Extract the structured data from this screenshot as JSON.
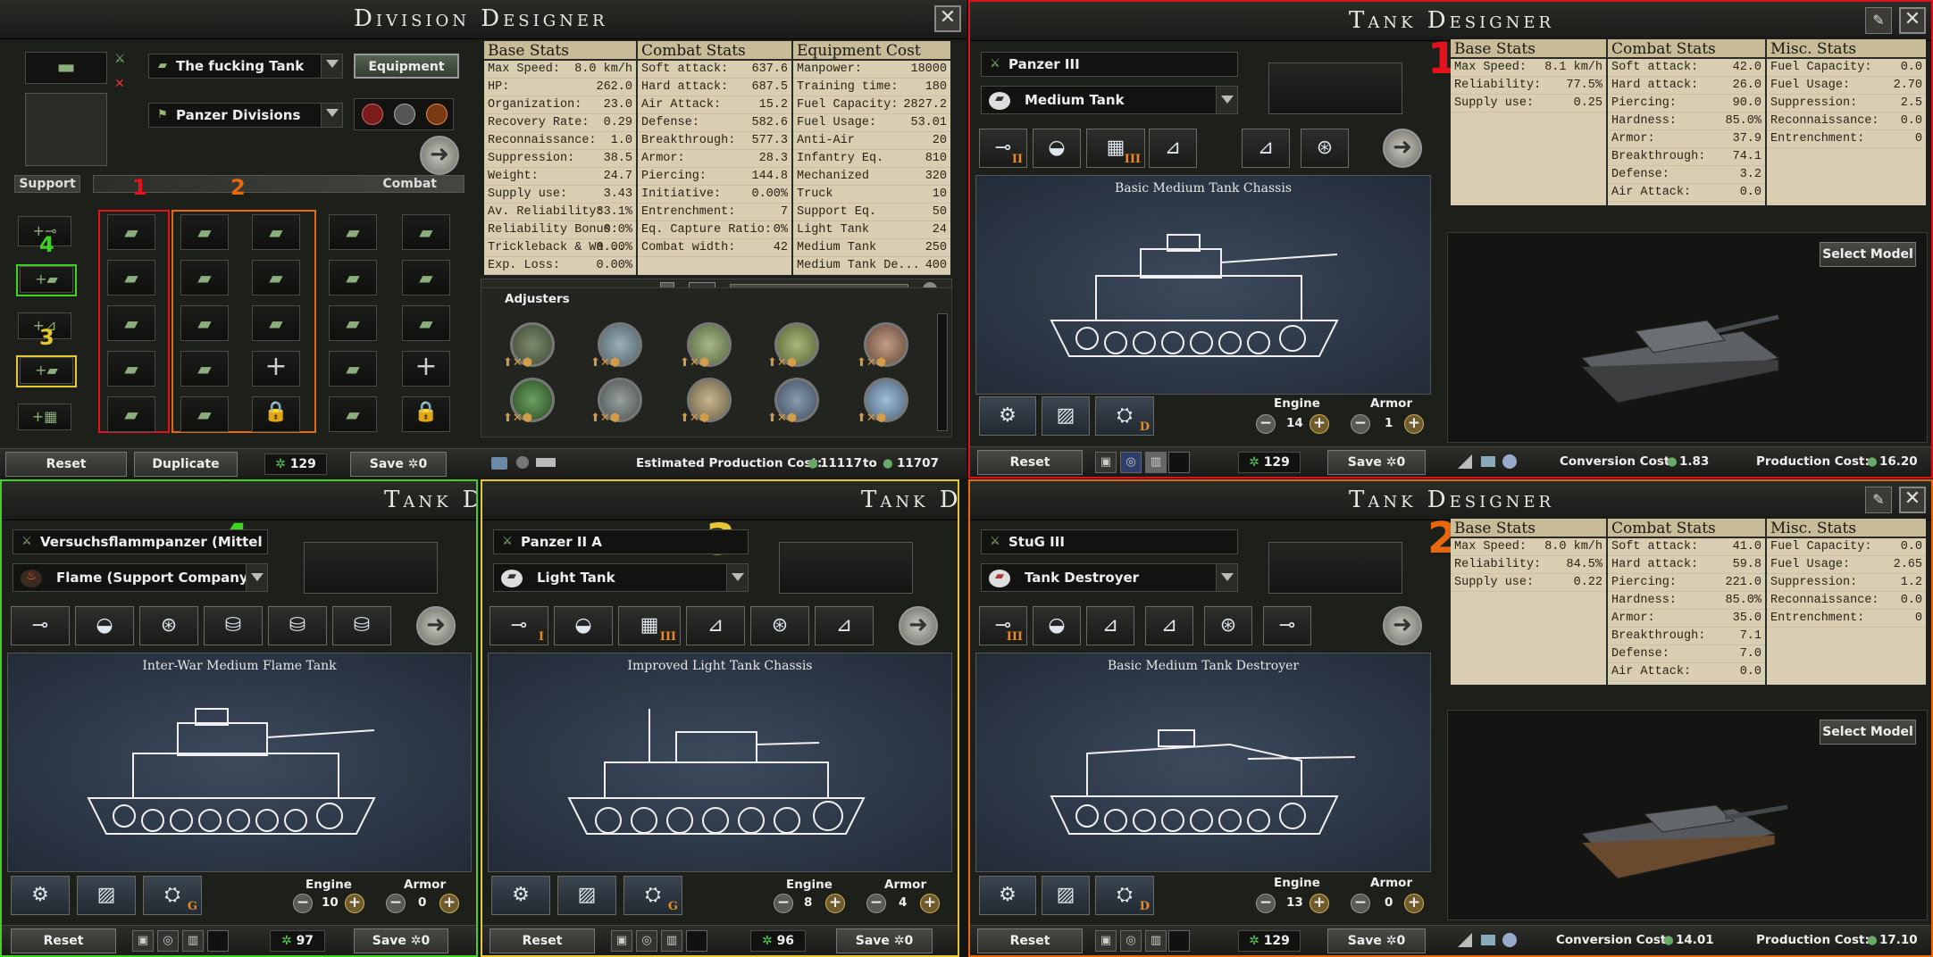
{
  "division": {
    "title": "Division Designer",
    "close": "✕",
    "name": "The fucking Tank",
    "equipment_button": "Equipment",
    "template_group": "Panzer Divisions",
    "support_label": "Support",
    "combat_label": "Combat",
    "column_markers": [
      "1",
      "2"
    ],
    "support_markers": [
      "4",
      "3"
    ],
    "headers": [
      "Base Stats",
      "Combat Stats",
      "Equipment Cost"
    ],
    "base_stats": [
      [
        "Max Speed:",
        "8.0 km/h"
      ],
      [
        "HP:",
        "262.0"
      ],
      [
        "Organization:",
        "23.0"
      ],
      [
        "Recovery Rate:",
        "0.29"
      ],
      [
        "Reconnaissance:",
        "1.0"
      ],
      [
        "Suppression:",
        "38.5"
      ],
      [
        "Weight:",
        "24.7"
      ],
      [
        "Supply use:",
        "3.43"
      ],
      [
        "Av. Reliability:",
        "83.1%"
      ],
      [
        "Reliability Bonus:",
        "0.0%"
      ],
      [
        "Trickleback & Wa...",
        "0.00%"
      ],
      [
        "Exp. Loss:",
        "0.00%"
      ]
    ],
    "combat_stats": [
      [
        "Soft attack:",
        "637.6"
      ],
      [
        "Hard attack:",
        "687.5"
      ],
      [
        "Air Attack:",
        "15.2"
      ],
      [
        "Defense:",
        "582.6"
      ],
      [
        "Breakthrough:",
        "577.3"
      ],
      [
        "Armor:",
        "28.3"
      ],
      [
        "Piercing:",
        "144.8"
      ],
      [
        "Initiative:",
        "0.00%"
      ],
      [
        "Entrenchment:",
        "7"
      ],
      [
        "Eq. Capture Ratio:",
        "0%"
      ],
      [
        "Combat width:",
        "42"
      ]
    ],
    "equipment_cost": [
      [
        "Manpower:",
        "18000"
      ],
      [
        "Training time:",
        "180"
      ],
      [
        "Fuel Capacity:",
        "2827.2"
      ],
      [
        "Fuel Usage:",
        "53.01"
      ],
      [
        "Anti-Air",
        "20"
      ],
      [
        "Infantry Eq.",
        "810"
      ],
      [
        "Mechanized",
        "320"
      ],
      [
        "Truck",
        "10"
      ],
      [
        "Support Eq.",
        "50"
      ],
      [
        "Light Tank",
        "24"
      ],
      [
        "Medium Tank",
        "250"
      ],
      [
        "Medium Tank De...",
        "400"
      ]
    ],
    "adjusters_label": "Adjusters",
    "reset": "Reset",
    "duplicate": "Duplicate",
    "xp": "129",
    "save": "Save ✲0",
    "estimated_cost_label": "Estimated Production Cost:",
    "cost_from": "11117",
    "cost_to_word": "to",
    "cost_to": "11707"
  },
  "tank1": {
    "title": "Tank Designer",
    "marker": "1",
    "name": "Panzer III",
    "role": "Medium Tank",
    "blueprint": "Basic Medium Tank Chassis",
    "headers": [
      "Base Stats",
      "Combat Stats",
      "Misc. Stats"
    ],
    "base_stats": [
      [
        "Max Speed:",
        "8.1 km/h"
      ],
      [
        "Reliability:",
        "77.5%"
      ],
      [
        "Supply use:",
        "0.25"
      ]
    ],
    "combat_stats": [
      [
        "Soft attack:",
        "42.0"
      ],
      [
        "Hard attack:",
        "26.0"
      ],
      [
        "Piercing:",
        "90.0"
      ],
      [
        "Hardness:",
        "85.0%"
      ],
      [
        "Armor:",
        "37.9"
      ],
      [
        "Breakthrough:",
        "74.1"
      ],
      [
        "Defense:",
        "3.2"
      ],
      [
        "Air Attack:",
        "0.0"
      ]
    ],
    "misc_stats": [
      [
        "Fuel Capacity:",
        "0.0"
      ],
      [
        "Fuel Usage:",
        "2.70"
      ],
      [
        "Suppression:",
        "2.5"
      ],
      [
        "Reconnaissance:",
        "0.0"
      ],
      [
        "Entrenchment:",
        "0"
      ]
    ],
    "select_model": "Select Model",
    "engine_label": "Engine",
    "engine_value": "14",
    "armor_label": "Armor",
    "armor_value": "1",
    "reset": "Reset",
    "xp": "129",
    "save": "Save ✲0",
    "conversion_label": "Conversion Cost:",
    "conversion_value": "1.83",
    "production_label": "Production Cost:",
    "production_value": "16.20"
  },
  "tank2": {
    "title": "Tank Designer",
    "marker": "2",
    "name": "StuG III",
    "role": "Tank Destroyer",
    "blueprint": "Basic Medium Tank Destroyer",
    "headers": [
      "Base Stats",
      "Combat Stats",
      "Misc. Stats"
    ],
    "base_stats": [
      [
        "Max Speed:",
        "8.0 km/h"
      ],
      [
        "Reliability:",
        "84.5%"
      ],
      [
        "Supply use:",
        "0.22"
      ]
    ],
    "combat_stats": [
      [
        "Soft attack:",
        "41.0"
      ],
      [
        "Hard attack:",
        "59.8"
      ],
      [
        "Piercing:",
        "221.0"
      ],
      [
        "Hardness:",
        "85.0%"
      ],
      [
        "Armor:",
        "35.0"
      ],
      [
        "Breakthrough:",
        "7.1"
      ],
      [
        "Defense:",
        "7.0"
      ],
      [
        "Air Attack:",
        "0.0"
      ]
    ],
    "misc_stats": [
      [
        "Fuel Capacity:",
        "0.0"
      ],
      [
        "Fuel Usage:",
        "2.65"
      ],
      [
        "Suppression:",
        "1.2"
      ],
      [
        "Reconnaissance:",
        "0.0"
      ],
      [
        "Entrenchment:",
        "0"
      ]
    ],
    "select_model": "Select Model",
    "engine_label": "Engine",
    "engine_value": "13",
    "armor_label": "Armor",
    "armor_value": "0",
    "reset": "Reset",
    "xp": "129",
    "save": "Save ✲0",
    "conversion_label": "Conversion Cost:",
    "conversion_value": "14.01",
    "production_label": "Production Cost:",
    "production_value": "17.10"
  },
  "tank3": {
    "title": "Tank De",
    "marker": "3",
    "name": "Panzer II A",
    "role": "Light Tank",
    "blueprint": "Improved Light Tank Chassis",
    "engine_label": "Engine",
    "engine_value": "8",
    "armor_label": "Armor",
    "armor_value": "4",
    "reset": "Reset",
    "xp": "96",
    "save": "Save ✲0"
  },
  "tank4": {
    "title": "Tank De",
    "marker": "4",
    "name": "Versuchsflammpanzer (Mittel",
    "role": "Flame (Support Company)",
    "blueprint": "Inter-War Medium Flame Tank",
    "engine_label": "Engine",
    "engine_value": "10",
    "armor_label": "Armor",
    "armor_value": "0",
    "reset": "Reset",
    "xp": "97",
    "save": "Save ✲0"
  },
  "colors": {
    "marker_red": "#e4121b",
    "marker_orange": "#e8690d",
    "marker_yellow": "#e8c830",
    "marker_green": "#3fd220",
    "parchment": "#d9ceb1"
  }
}
